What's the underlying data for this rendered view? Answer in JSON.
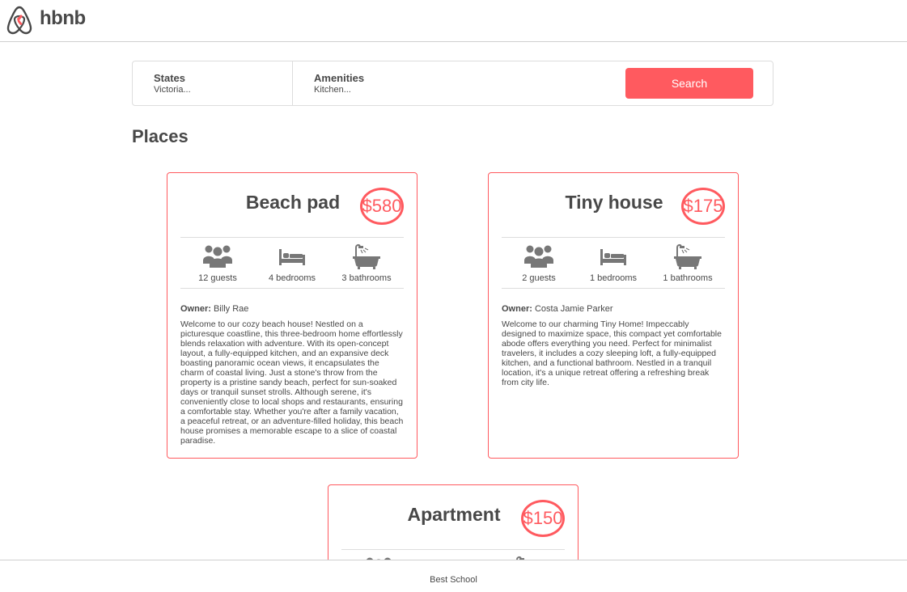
{
  "header": {
    "logo_text": "hbnb"
  },
  "filters": {
    "states": {
      "title": "States",
      "value": "Victoria..."
    },
    "amenities": {
      "title": "Amenities",
      "value": "Kitchen..."
    },
    "search_label": "Search"
  },
  "places_title": "Places",
  "places": [
    {
      "name": "Beach pad",
      "price": "$580",
      "guests": "12 guests",
      "bedrooms": "4 bedrooms",
      "bathrooms": "3 bathrooms",
      "owner_label": "Owner:",
      "owner": "Billy Rae",
      "description": "Welcome to our cozy beach house! Nestled on a picturesque coastline, this three-bedroom home effortlessly blends relaxation with adventure. With its open-concept layout, a fully-equipped kitchen, and an expansive deck boasting panoramic ocean views, it encapsulates the charm of coastal living. Just a stone's throw from the property is a pristine sandy beach, perfect for sun-soaked days or tranquil sunset strolls. Although serene, it's conveniently close to local shops and restaurants, ensuring a comfortable stay. Whether you're after a family vacation, a peaceful retreat, or an adventure-filled holiday, this beach house promises a memorable escape to a slice of coastal paradise."
    },
    {
      "name": "Tiny house",
      "price": "$175",
      "guests": "2 guests",
      "bedrooms": "1 bedrooms",
      "bathrooms": "1 bathrooms",
      "owner_label": "Owner:",
      "owner": "Costa Jamie Parker",
      "description": "Welcome to our charming Tiny Home! Impeccably designed to maximize space, this compact yet comfortable abode offers everything you need. Perfect for minimalist travelers, it includes a cozy sleeping loft, a fully-equipped kitchen, and a functional bathroom. Nestled in a tranquil location, it's a unique retreat offering a refreshing break from city life."
    },
    {
      "name": "Apartment",
      "price": "$150"
    }
  ],
  "icons": {
    "logo": "airbnb-logo-icon",
    "guests": "group-icon",
    "bedrooms": "bed-icon",
    "bathrooms": "bathtub-icon"
  },
  "colors": {
    "accent": "#ff5a5f",
    "text": "#484848",
    "border": "#dddddd"
  },
  "footer": {
    "text": "Best School"
  }
}
